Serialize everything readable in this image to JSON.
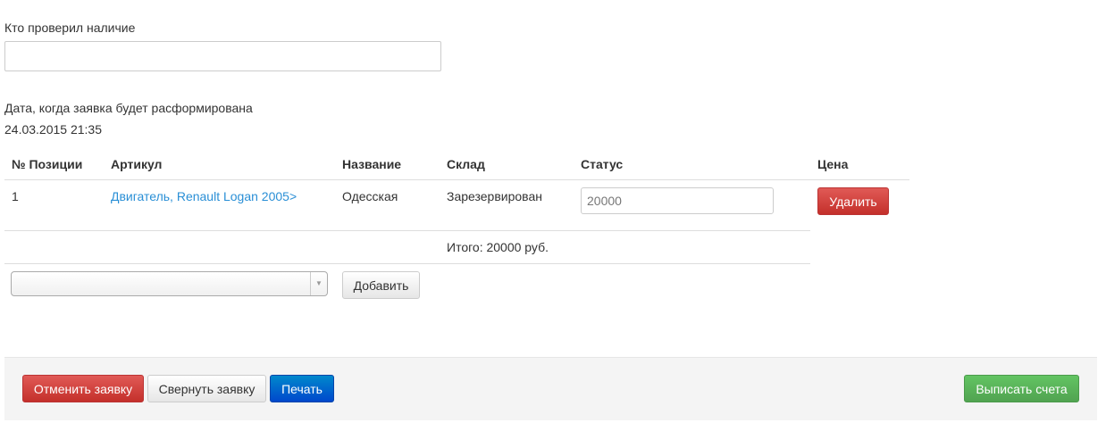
{
  "checker": {
    "label": "Кто проверил наличие",
    "value": ""
  },
  "disband": {
    "label": "Дата, когда заявка будет расформирована",
    "value": "24.03.2015 21:35"
  },
  "table": {
    "headers": [
      "№ Позиции",
      "Артикул",
      "Название",
      "Склад",
      "Статус",
      "Цена"
    ],
    "rows": [
      {
        "num": "1",
        "article": "Двигатель, Renault Logan 2005>",
        "name": "Одесская",
        "warehouse": "Зарезервирован",
        "price": "20000",
        "delete": "Удалить"
      }
    ],
    "total": "Итого: 20000 руб."
  },
  "add": {
    "select_value": "",
    "button": "Добавить"
  },
  "footer": {
    "cancel": "Отменить заявку",
    "collapse": "Свернуть заявку",
    "print": "Печать",
    "invoice": "Выписать счета"
  }
}
